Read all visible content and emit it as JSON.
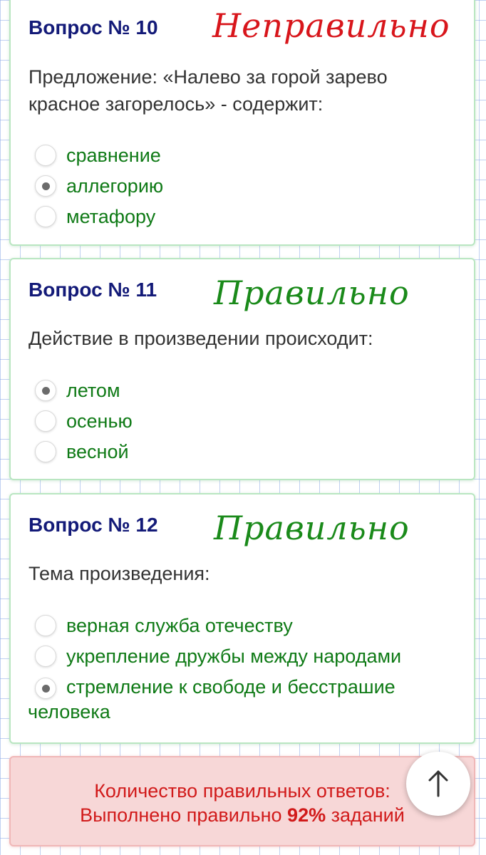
{
  "questions": [
    {
      "title": "Вопрос № 10",
      "verdict": "Неправильно",
      "verdict_color": "#d8151b",
      "text": "Предложение: «Налево за горой зарево красное загорелось» - содержит:",
      "options": [
        {
          "label": "сравнение",
          "checked": false
        },
        {
          "label": "аллегорию",
          "checked": true
        },
        {
          "label": "метафору",
          "checked": false
        }
      ]
    },
    {
      "title": "Вопрос № 11",
      "verdict": "Правильно",
      "verdict_color": "#1a8a1a",
      "text": "Действие в произведении происходит:",
      "options": [
        {
          "label": "летом",
          "checked": true
        },
        {
          "label": "осенью",
          "checked": false
        },
        {
          "label": "весной",
          "checked": false
        }
      ]
    },
    {
      "title": "Вопрос № 12",
      "verdict": "Правильно",
      "verdict_color": "#1a8a1a",
      "text": "Тема произведения:",
      "options": [
        {
          "label": "верная служба отечеству",
          "checked": false
        },
        {
          "label": "укрепление дружбы между народами",
          "checked": false
        },
        {
          "label": "стремление к свободе и бесстрашие человека",
          "checked": true
        }
      ]
    }
  ],
  "result": {
    "line1": "Количество правильных ответов:",
    "line2_prefix": "Выполнено правильно",
    "percent": "92%",
    "line2_suffix": "заданий"
  },
  "scroll_top": {
    "icon": "arrow-up-icon"
  }
}
